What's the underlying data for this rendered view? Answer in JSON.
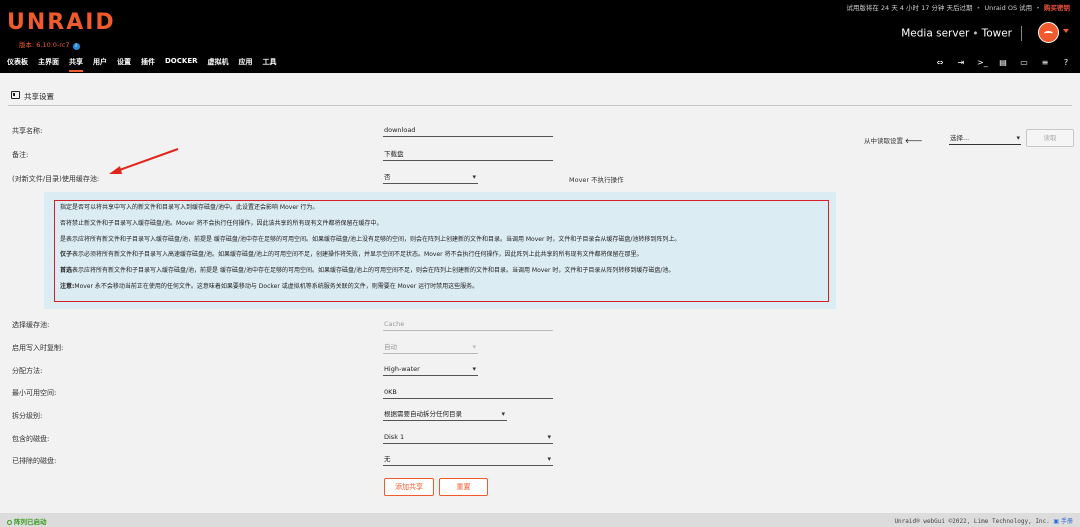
{
  "header": {
    "trial_text": "试用版将在 24 天 4 小时 17 分钟 天后过期",
    "os_text": "Unraid OS 试用",
    "buy_text": "购买密钥",
    "logo": "UNRAID",
    "version": "版本: 6.10.0-rc7",
    "server_desc": "Media server",
    "server_name": "Tower",
    "brand_color": "#f15a2c"
  },
  "nav": {
    "items": [
      "仪表板",
      "主界面",
      "共享",
      "用户",
      "设置",
      "插件",
      "DOCKER",
      "虚拟机",
      "应用",
      "工具"
    ],
    "active_index": 2,
    "icons": [
      "terminal-split-icon",
      "logout-icon",
      "terminal-icon",
      "log-icon",
      "monitor-icon",
      "list-icon",
      "help-icon"
    ]
  },
  "panel": {
    "title": "共享设置"
  },
  "form": {
    "share_name_label": "共享名称:",
    "share_name_value": "download",
    "comment_label": "备注:",
    "comment_value": "下载盘",
    "use_cache_label": "(对新文件/目录)使用缓存池:",
    "use_cache_value": "否",
    "use_cache_hint": "Mover 不执行操作",
    "select_cache_label": "选择缓存池:",
    "select_cache_value": "Cache",
    "cow_label": "启用写入时复制:",
    "cow_value": "自动",
    "alloc_label": "分配方法:",
    "alloc_value": "High-water",
    "min_free_label": "最小可用空间:",
    "min_free_value": "0KB",
    "split_label": "拆分级别:",
    "split_value": "根据需要自动拆分任何目录",
    "include_label": "包含的磁盘:",
    "include_value": "Disk 1",
    "exclude_label": "已排除的磁盘:",
    "exclude_value": "无"
  },
  "readfrom": {
    "label": "从中读取设置",
    "select_value": "选择...",
    "button": "读取"
  },
  "help": {
    "p1": "指定是否可以将共享中写入的新文件和目录写入到缓存磁盘/池中。此设置还会影响 Mover 行为。",
    "p2": "否将禁止新文件和子目录写入缓存磁盘/池。Mover 将不会执行任何操作，因此该共享的所有现有文件都将保留在缓存中。",
    "p3": "是表示应将所有新文件和子目录写入缓存磁盘/池，前提是 缓存磁盘/池中存在足够的可用空间。如果缓存磁盘/池上没有足够的空间，则会在阵列上创建新的文件和目录。当调用 Mover 时，文件和子目录会从缓存磁盘/池转移到阵列上。",
    "p4_bold": "仅子",
    "p4": "表示必须将所有新文件和子目录写入高速缓存磁盘/池。如果缓存磁盘/池上的可用空间不足，创建操作将失败，并显示空间不足状态。Mover 将不会执行任何操作，因此阵列上此共享的所有现有文件都将保留在那里。",
    "p5_bold": "首选",
    "p5": "表示应将所有新文件和子目录写入缓存磁盘/池，前提是 缓存磁盘/池中存在足够的可用空间。如果缓存磁盘/池上的可用空间不足，则会在阵列上创建新的文件和目录。当调用 Mover 时，文件和子目录从阵列转移到缓存磁盘/池。",
    "p6_bold": "注意:",
    "p6": "Mover 永不会移动当前正在使用的任何文件。这意味着如果要移动与 Docker 或虚拟机等系统服务关联的文件，则需要在 Mover 运行时禁用这些服务。"
  },
  "buttons": {
    "add": "添加共享",
    "reset": "重置"
  },
  "footer": {
    "status": "阵列已启动",
    "copyright": "Unraid® webGui ©2022, Lime Technology, Inc.",
    "manual": "手册"
  }
}
